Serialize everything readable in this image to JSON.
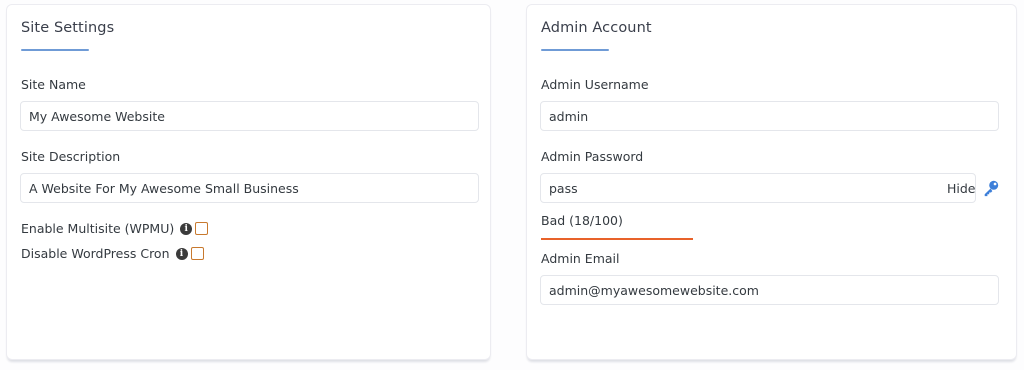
{
  "site_settings": {
    "title": "Site Settings",
    "site_name": {
      "label": "Site Name",
      "value": "My Awesome Website"
    },
    "site_description": {
      "label": "Site Description",
      "value": "A Website For My Awesome Small Business"
    },
    "multisite": {
      "label": "Enable Multisite (WPMU)",
      "icon": "info-icon",
      "checked": false
    },
    "disable_cron": {
      "label": "Disable WordPress Cron",
      "icon": "info-icon",
      "checked": false
    }
  },
  "admin_account": {
    "title": "Admin Account",
    "username": {
      "label": "Admin Username",
      "value": "admin"
    },
    "password": {
      "label": "Admin Password",
      "value": "pass",
      "toggle_label": "Hide",
      "generate_icon": "key-icon"
    },
    "strength": {
      "text": "Bad (18/100)",
      "score": 18,
      "max": 100,
      "color": "#e8622a"
    },
    "email": {
      "label": "Admin Email",
      "value": "admin@myawesomewebsite.com"
    }
  },
  "colors": {
    "accent_underline": "#6f9bd6",
    "checkbox_border": "#c8792e",
    "key_icon": "#3d7fd9"
  }
}
